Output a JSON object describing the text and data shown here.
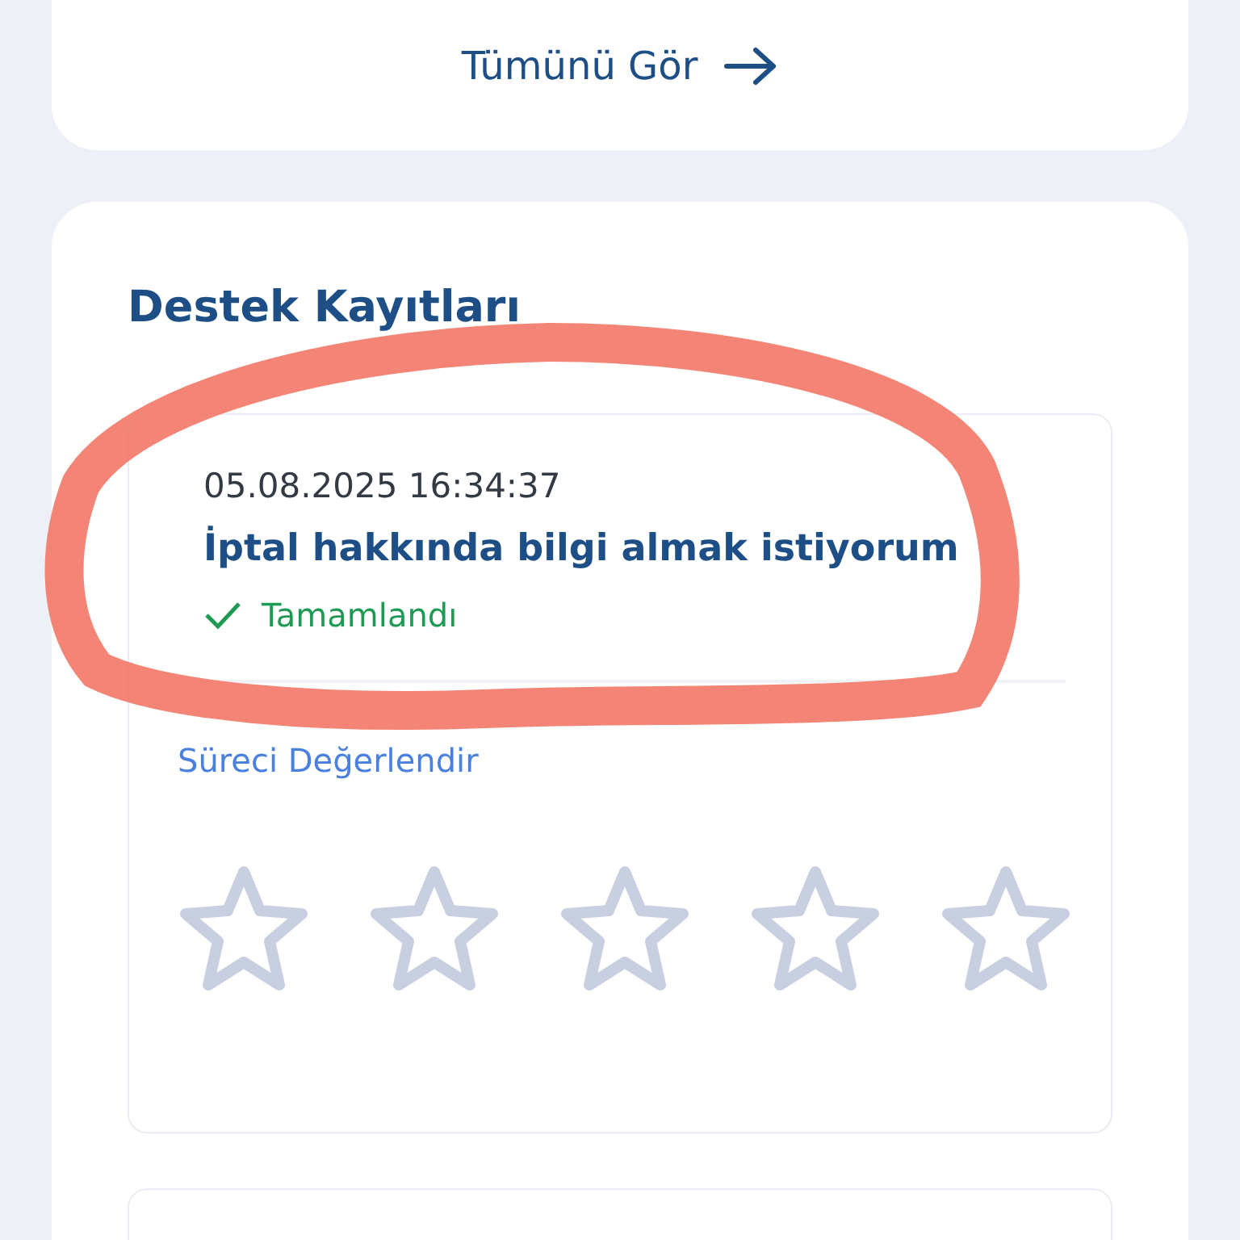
{
  "see_all_link": {
    "label": "Tümünü Gör"
  },
  "support_section": {
    "title": "Destek Kayıtları",
    "tickets": [
      {
        "datetime": "05.08.2025 16:34:37",
        "subject": "İptal hakkında bilgi almak istiyorum",
        "status": "Tamamlandı",
        "completed": true,
        "rate_label": "Süreci Değerlendir",
        "stars": 0
      }
    ]
  }
}
